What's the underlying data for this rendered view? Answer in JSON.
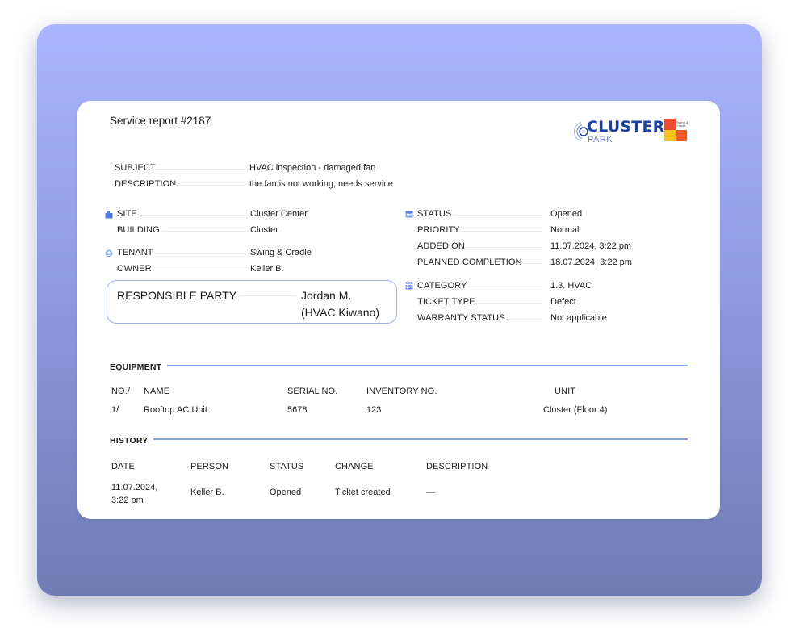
{
  "report": {
    "title": "Service report #2187"
  },
  "logo": {
    "main": "CLUSTER",
    "sub": "PARK",
    "block_text": "Swing & Cradle"
  },
  "details": {
    "subject_label": "SUBJECT",
    "subject_value": "HVAC inspection - damaged fan",
    "description_label": "DESCRIPTION",
    "description_value": "the fan is not working, needs service"
  },
  "location": {
    "site_label": "SITE",
    "site_value": "Cluster Center",
    "building_label": "BUILDING",
    "building_value": "Cluster",
    "tenant_label": "TENANT",
    "tenant_value": "Swing & Cradle",
    "owner_label": "OWNER",
    "owner_value": "Keller B."
  },
  "responsible": {
    "label": "RESPONSIBLE PARTY",
    "value_line1": "Jordan M.",
    "value_line2": "(HVAC Kiwano)"
  },
  "status": {
    "status_label": "STATUS",
    "status_value": "Opened",
    "priority_label": "PRIORITY",
    "priority_value": "Normal",
    "added_label": "ADDED ON",
    "added_value": "11.07.2024, 3:22 pm",
    "planned_label": "PLANNED COMPLETION",
    "planned_value": "18.07.2024, 3:22 pm",
    "category_label": "CATEGORY",
    "category_value": "1.3. HVAC",
    "type_label": "TICKET TYPE",
    "type_value": "Defect",
    "warranty_label": "WARRANTY STATUS",
    "warranty_value": "Not applicable"
  },
  "equipment": {
    "title": "EQUIPMENT",
    "headers": [
      "NO./",
      "NAME",
      "SERIAL NO.",
      "INVENTORY NO.",
      "UNIT"
    ],
    "rows": [
      [
        "1/",
        "Rooftop AC Unit",
        "5678",
        "123",
        "Cluster (Floor 4)"
      ]
    ]
  },
  "history": {
    "title": "HISTORY",
    "headers": [
      "DATE",
      "PERSON",
      "STATUS",
      "CHANGE",
      "DESCRIPTION"
    ],
    "rows": [
      {
        "date_line1": "11.07.2024,",
        "date_line2": "3:22 pm",
        "person": "Keller B.",
        "status": "Opened",
        "change": "Ticket created",
        "description": "—"
      }
    ]
  },
  "colors": {
    "accent_line": "#7f9ce6",
    "logo_blue": "#1b3fa6",
    "icon_blue": "#4b7be0"
  }
}
